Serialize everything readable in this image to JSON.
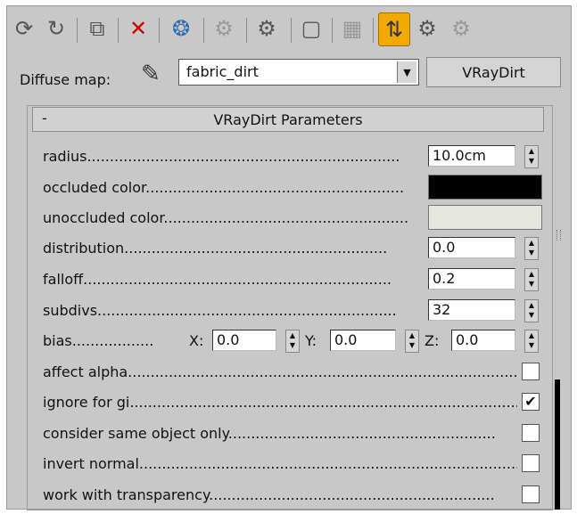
{
  "toolbar": {
    "icons": [
      "get-material-icon",
      "put-to-scene-icon",
      "assign-to-selection-icon",
      "reset-map-icon",
      "make-unique-icon",
      "put-to-library-icon",
      "material-id-channel-icon",
      "show-in-viewport-icon",
      "show-end-result-icon",
      "go-to-parent-icon",
      "go-forward-to-sibling-icon",
      "material-map-navigator-icon"
    ]
  },
  "diffuse": {
    "label": "Diffuse map:",
    "map_name": "fabric_dirt",
    "map_type": "VRayDirt"
  },
  "rollout": {
    "collapse_symbol": "-",
    "title": "VRayDirt Parameters"
  },
  "params": {
    "radius": {
      "label": "radius.....................................................................",
      "value": "10.0cm"
    },
    "occluded_color": {
      "label": "occluded color.........................................................",
      "color": "#000000"
    },
    "unoccluded_color": {
      "label": "unoccluded color......................................................",
      "color": "#e6e6e0"
    },
    "distribution": {
      "label": "distribution..........................................................",
      "value": "0.0"
    },
    "falloff": {
      "label": "falloff....................................................................",
      "value": "0.2"
    },
    "subdivs": {
      "label": "subdivs..................................................................",
      "value": "32"
    },
    "bias": {
      "label": "bias..................",
      "x_label": "X:",
      "x": "0.0",
      "y_label": "Y:",
      "y": "0.0",
      "z_label": "Z:",
      "z": "0.0"
    },
    "affect_alpha": {
      "label": "affect alpha.......................................................................................",
      "checked": false,
      "mark": ""
    },
    "ignore_for_gi": {
      "label": "ignore for gi.......................................................................................",
      "checked": true,
      "mark": "✔"
    },
    "consider_same_object_only": {
      "label": "consider same object only...........................................................",
      "checked": false,
      "mark": ""
    },
    "invert_normal": {
      "label": "invert normal.......................................................................................",
      "checked": false,
      "mark": ""
    },
    "work_with_transparency": {
      "label": "work with transparency...............................................................",
      "checked": false,
      "mark": ""
    }
  }
}
